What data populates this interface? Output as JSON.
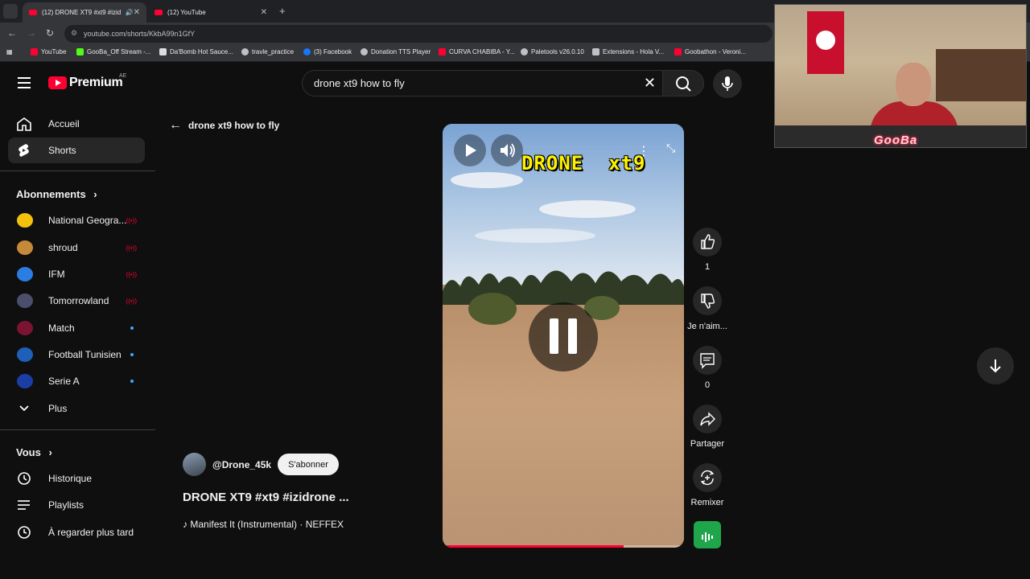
{
  "browser": {
    "tabs": [
      {
        "label": "(12) DRONE XT9 #xt9 #izid",
        "active": true
      },
      {
        "label": "(12) YouTube",
        "active": false
      }
    ],
    "url": "youtube.com/shorts/KkbA99n1GfY",
    "bookmarks": [
      {
        "label": "YouTube",
        "color": "#ff0033"
      },
      {
        "label": "GooBa_Off Stream -...",
        "color": "#53fc18"
      },
      {
        "label": "Da'Bomb Hot Sauce...",
        "color": "#dddddd"
      },
      {
        "label": "travle_practice",
        "color": "#bdc1c6"
      },
      {
        "label": "(3) Facebook",
        "color": "#1877f2"
      },
      {
        "label": "Donation TTS Player",
        "color": "#bdc1c6"
      },
      {
        "label": "CURVA CHABIBA - Y...",
        "color": "#ff0033"
      },
      {
        "label": "Paletools v26.0.10",
        "color": "#bdc1c6"
      },
      {
        "label": "Extensions - Hola V...",
        "color": "#bdc1c6"
      },
      {
        "label": "Goobathon - Veroni...",
        "color": "#ff0033"
      }
    ]
  },
  "header": {
    "logo_text": "Premium",
    "country_code": "AE",
    "search_value": "drone xt9 how to fly"
  },
  "sidebar": {
    "main": [
      {
        "label": "Accueil",
        "icon": "home-icon"
      },
      {
        "label": "Shorts",
        "icon": "shorts-icon",
        "active": true
      }
    ],
    "subscriptions_title": "Abonnements",
    "subscriptions": [
      {
        "label": "National Geogra...",
        "indicator": "live",
        "color": "#f4c20d"
      },
      {
        "label": "shroud",
        "indicator": "live",
        "color": "#c48a3a"
      },
      {
        "label": "IFM",
        "indicator": "live",
        "color": "#2a7de1"
      },
      {
        "label": "Tomorrowland",
        "indicator": "live",
        "color": "#4b4f6b"
      },
      {
        "label": "Match",
        "indicator": "new",
        "color": "#7a1430"
      },
      {
        "label": "Football Tunisien",
        "indicator": "new",
        "color": "#1e5fb8"
      },
      {
        "label": "Serie A",
        "indicator": "new",
        "color": "#1b3ea6"
      }
    ],
    "more_label": "Plus",
    "you_title": "Vous",
    "you_items": [
      {
        "label": "Historique",
        "icon": "history-icon"
      },
      {
        "label": "Playlists",
        "icon": "playlists-icon"
      },
      {
        "label": "À regarder plus tard",
        "icon": "watch-later-icon"
      }
    ]
  },
  "main": {
    "back_label": "drone xt9 how to fly",
    "video_overlay_text": "DRONE  xt9",
    "progress": 0.75,
    "channel_name": "@Drone_45k",
    "subscribe_label": "S'abonner",
    "short_title": "DRONE XT9  #xt9 #izidrone ...",
    "music_label": "Manifest It (Instrumental) · NEFFEX"
  },
  "actions": {
    "like_count": "1",
    "dislike_label": "Je n'aim...",
    "comment_count": "0",
    "share_label": "Partager",
    "remix_label": "Remixer"
  },
  "webcam": {
    "overlay_label": "GooBa"
  }
}
